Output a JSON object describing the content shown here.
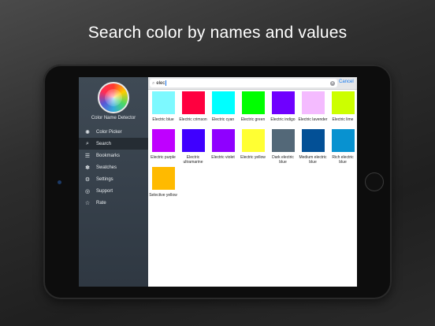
{
  "headline": "Search color by names and values",
  "sidebar": {
    "app_name": "Color Name Detector",
    "items": [
      {
        "label": "Color Picker",
        "icon": "palette-icon",
        "glyph": "✺",
        "active": false
      },
      {
        "label": "Search",
        "icon": "search-icon",
        "glyph": "⌕",
        "active": true
      },
      {
        "label": "Bookmarks",
        "icon": "bookmark-icon",
        "glyph": "☰",
        "active": false
      },
      {
        "label": "Swatches",
        "icon": "swatches-icon",
        "glyph": "✽",
        "active": false
      },
      {
        "label": "Settings",
        "icon": "gear-icon",
        "glyph": "⚙",
        "active": false
      },
      {
        "label": "Support",
        "icon": "support-icon",
        "glyph": "◎",
        "active": false
      },
      {
        "label": "Rate",
        "icon": "star-icon",
        "glyph": "☆",
        "active": false
      }
    ]
  },
  "search": {
    "value": "elec",
    "cancel_label": "Cancel"
  },
  "results": [
    {
      "name": "Electric blue",
      "color": "#7df9ff"
    },
    {
      "name": "Electric crimson",
      "color": "#ff003f"
    },
    {
      "name": "Electric cyan",
      "color": "#00ffff"
    },
    {
      "name": "Electric green",
      "color": "#00ff00"
    },
    {
      "name": "Electric indigo",
      "color": "#6f00ff"
    },
    {
      "name": "Electric lavender",
      "color": "#f4bbff"
    },
    {
      "name": "Electric lime",
      "color": "#ccff00"
    },
    {
      "name": "Electric purple",
      "color": "#bf00ff"
    },
    {
      "name": "Electric ultramarine",
      "color": "#3f00ff"
    },
    {
      "name": "Electric violet",
      "color": "#8f00ff"
    },
    {
      "name": "Electric yellow",
      "color": "#ffff33"
    },
    {
      "name": "Dark electric blue",
      "color": "#536878"
    },
    {
      "name": "Medium electric blue",
      "color": "#035096"
    },
    {
      "name": "Rich electric blue",
      "color": "#0892d0"
    },
    {
      "name": "Selective yellow",
      "color": "#ffba00"
    }
  ]
}
